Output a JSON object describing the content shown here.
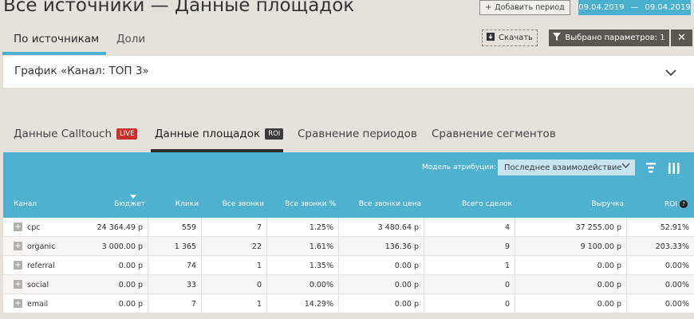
{
  "header": {
    "title": "Все источники — Данные площадок",
    "add_period": "Добавить период",
    "date_from": "09.04.2019",
    "date_sep": "—",
    "date_to": "09.04.2019"
  },
  "main_tabs": [
    {
      "label": "По источникам",
      "active": true
    },
    {
      "label": "Доли",
      "active": false
    }
  ],
  "actions": {
    "download": "Скачать",
    "filter": "Выбрано параметров: 1",
    "close": "✕"
  },
  "chart_panel": {
    "title": "График «Канал: ТОП 3»"
  },
  "sub_tabs": [
    {
      "label": "Данные Calltouch",
      "badge": "LIVE"
    },
    {
      "label": "Данные площадок",
      "badge": "ROI",
      "active": true
    },
    {
      "label": "Сравнение периодов"
    },
    {
      "label": "Сравнение сегментов"
    }
  ],
  "attribution": {
    "label": "Модель атрибуции:",
    "value": "Последнее взаимодействие"
  },
  "columns": [
    "Канал",
    "Бюджет",
    "Клики",
    "Все звонки",
    "Все звонки %",
    "Все звонки цена",
    "Всего сделок",
    "Выручка",
    "ROI"
  ],
  "rows": [
    {
      "channel": "cpc",
      "budget": "24 364.49 р",
      "clicks": "559",
      "calls": "7",
      "calls_pct": "1.25%",
      "call_price": "3 480.64 р",
      "deals": "4",
      "revenue": "37 255.00 р",
      "roi": "52.91%"
    },
    {
      "channel": "organic",
      "budget": "3 000.00 р",
      "clicks": "1 365",
      "calls": "22",
      "calls_pct": "1.61%",
      "call_price": "136.36 р",
      "deals": "9",
      "revenue": "9 100.00 р",
      "roi": "203.33%"
    },
    {
      "channel": "referral",
      "budget": "0.00 р",
      "clicks": "74",
      "calls": "1",
      "calls_pct": "1.35%",
      "call_price": "0.00 р",
      "deals": "1",
      "revenue": "0.00 р",
      "roi": "0.00%"
    },
    {
      "channel": "social",
      "budget": "0.00 р",
      "clicks": "33",
      "calls": "0",
      "calls_pct": "0.00%",
      "call_price": "0.00 р",
      "deals": "0",
      "revenue": "0.00 р",
      "roi": "0.00%"
    },
    {
      "channel": "email",
      "budget": "0.00 р",
      "clicks": "7",
      "calls": "1",
      "calls_pct": "14.29%",
      "call_price": "0.00 р",
      "deals": "0",
      "revenue": "0.00 р",
      "roi": "0.00%"
    }
  ],
  "colors": {
    "accent": "#4ab0cf",
    "table_header": "#4fb0cf",
    "live_badge": "#c8302e",
    "dark_button": "#5c5651"
  }
}
